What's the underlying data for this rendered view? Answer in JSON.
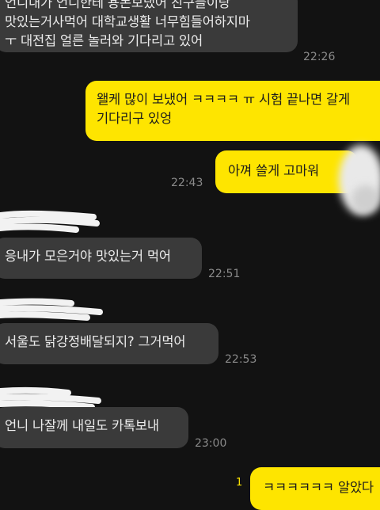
{
  "messages": [
    {
      "side": "in",
      "text": "언니내가 언니한테 용돈보냈어 친구들이랑\n맛있는거사먹어 대학교생활 너무힘들어하지마\nㅜ 대전집 얼른 놀러와 기다리고 있어",
      "time": "22:26"
    },
    {
      "side": "out",
      "text": "왤케 많이 보냈어 ㅋㅋㅋㅋ ㅠ 시험 끝나면 갈게\n기다리구 있엉",
      "time": ""
    },
    {
      "side": "out",
      "text": "아껴 쓸게 고마워",
      "time": "22:43"
    },
    {
      "side": "in",
      "text": "응내가 모은거야 맛있는거 먹어",
      "time": "22:51"
    },
    {
      "side": "in",
      "text": "서울도 닭강정배달되지? 그거먹어",
      "time": "22:53"
    },
    {
      "side": "in",
      "text": "언니 나잘께 내일도 카톡보내",
      "time": "23:00"
    },
    {
      "side": "out",
      "text": "ㅋㅋㅋㅋㅋㅋ 알았다",
      "time": "",
      "unread": "1"
    }
  ],
  "colors": {
    "background": "#121212",
    "incoming_bubble": "#3a3a3a",
    "outgoing_bubble": "#fee500",
    "timestamp": "#8a8a8a"
  }
}
